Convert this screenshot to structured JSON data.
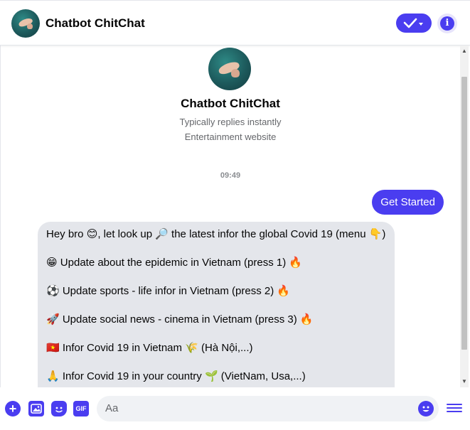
{
  "header": {
    "title": "Chatbot ChitChat"
  },
  "profile": {
    "name": "Chatbot ChitChat",
    "status": "Typically replies instantly",
    "category": "Entertainment website"
  },
  "conversation": {
    "timestamp": "09:49",
    "outgoing": {
      "text": "Get Started"
    },
    "incoming": {
      "lines": [
        "Hey bro 😊, let look up 🔎 the latest infor the global Covid 19 (menu 👇)",
        "😁 Update about the epidemic in Vietnam (press 1) 🔥",
        "⚽ Update sports - life infor in Vietnam (press 2) 🔥",
        "🚀 Update social news - cinema in Vietnam (press 3) 🔥",
        "🇻🇳 Infor Covid 19 in Vietnam 🌾 (Hà Nội,...)",
        "🙏 Infor Covid 19 in your country 🌱 (VietNam, Usa,...)"
      ]
    }
  },
  "composer": {
    "placeholder": "Aa",
    "gif_label": "GIF",
    "info_glyph": "i"
  },
  "colors": {
    "accent": "#4a3df0",
    "bubble_in": "#e4e6eb",
    "subtext": "#65676b"
  },
  "icons": [
    "avatar-image",
    "checkmark-dropdown-icon",
    "info-icon",
    "plus-icon",
    "image-icon",
    "sticker-icon",
    "gif-icon",
    "emoji-icon",
    "menu-icon"
  ]
}
